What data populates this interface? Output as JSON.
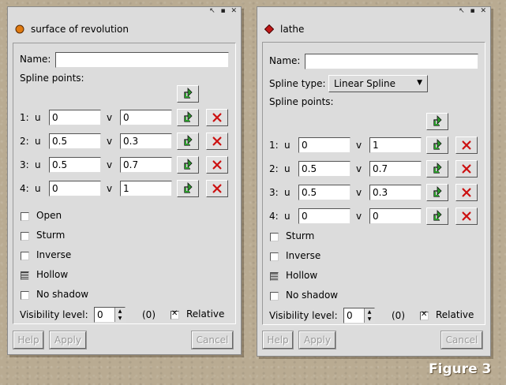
{
  "colors": {
    "surface_icon": "#e07a10",
    "lathe_icon": "#c01818",
    "delete_x": "#cc1111",
    "add_arrow": "#2a9a2a"
  },
  "window_controls": "↖ ▪ ✕",
  "caption": "Figure 3",
  "win1": {
    "icon": "orange-circle-icon",
    "title": "surface of revolution",
    "name_label": "Name:",
    "name_value": "",
    "spline_points_label": "Spline points:",
    "u_label": "u",
    "v_label": "v",
    "points": [
      {
        "index": "1:",
        "u": "0",
        "v": "0"
      },
      {
        "index": "2:",
        "u": "0.5",
        "v": "0.3"
      },
      {
        "index": "3:",
        "u": "0.5",
        "v": "0.7"
      },
      {
        "index": "4:",
        "u": "0",
        "v": "1"
      }
    ],
    "checkboxes": [
      {
        "label": "Open",
        "state": "unchecked"
      },
      {
        "label": "Sturm",
        "state": "unchecked"
      },
      {
        "label": "Inverse",
        "state": "unchecked"
      },
      {
        "label": "Hollow",
        "state": "indeterminate"
      },
      {
        "label": "No shadow",
        "state": "unchecked"
      }
    ],
    "visibility_label": "Visibility level:",
    "visibility_value": "0",
    "visibility_paren": "(0)",
    "relative_label": "Relative",
    "relative_checked": true,
    "buttons": {
      "help": "Help",
      "apply": "Apply",
      "cancel": "Cancel"
    }
  },
  "win2": {
    "icon": "red-diamond-icon",
    "title": "lathe",
    "name_label": "Name:",
    "name_value": "",
    "spline_type_label": "Spline type:",
    "spline_type_value": "Linear Spline",
    "spline_points_label": "Spline points:",
    "u_label": "u",
    "v_label": "v",
    "points": [
      {
        "index": "1:",
        "u": "0",
        "v": "1"
      },
      {
        "index": "2:",
        "u": "0.5",
        "v": "0.7"
      },
      {
        "index": "3:",
        "u": "0.5",
        "v": "0.3"
      },
      {
        "index": "4:",
        "u": "0",
        "v": "0"
      }
    ],
    "checkboxes": [
      {
        "label": "Sturm",
        "state": "unchecked"
      },
      {
        "label": "Inverse",
        "state": "unchecked"
      },
      {
        "label": "Hollow",
        "state": "indeterminate"
      },
      {
        "label": "No shadow",
        "state": "unchecked"
      }
    ],
    "visibility_label": "Visibility level:",
    "visibility_value": "0",
    "visibility_paren": "(0)",
    "relative_label": "Relative",
    "relative_checked": true,
    "buttons": {
      "help": "Help",
      "apply": "Apply",
      "cancel": "Cancel"
    }
  }
}
